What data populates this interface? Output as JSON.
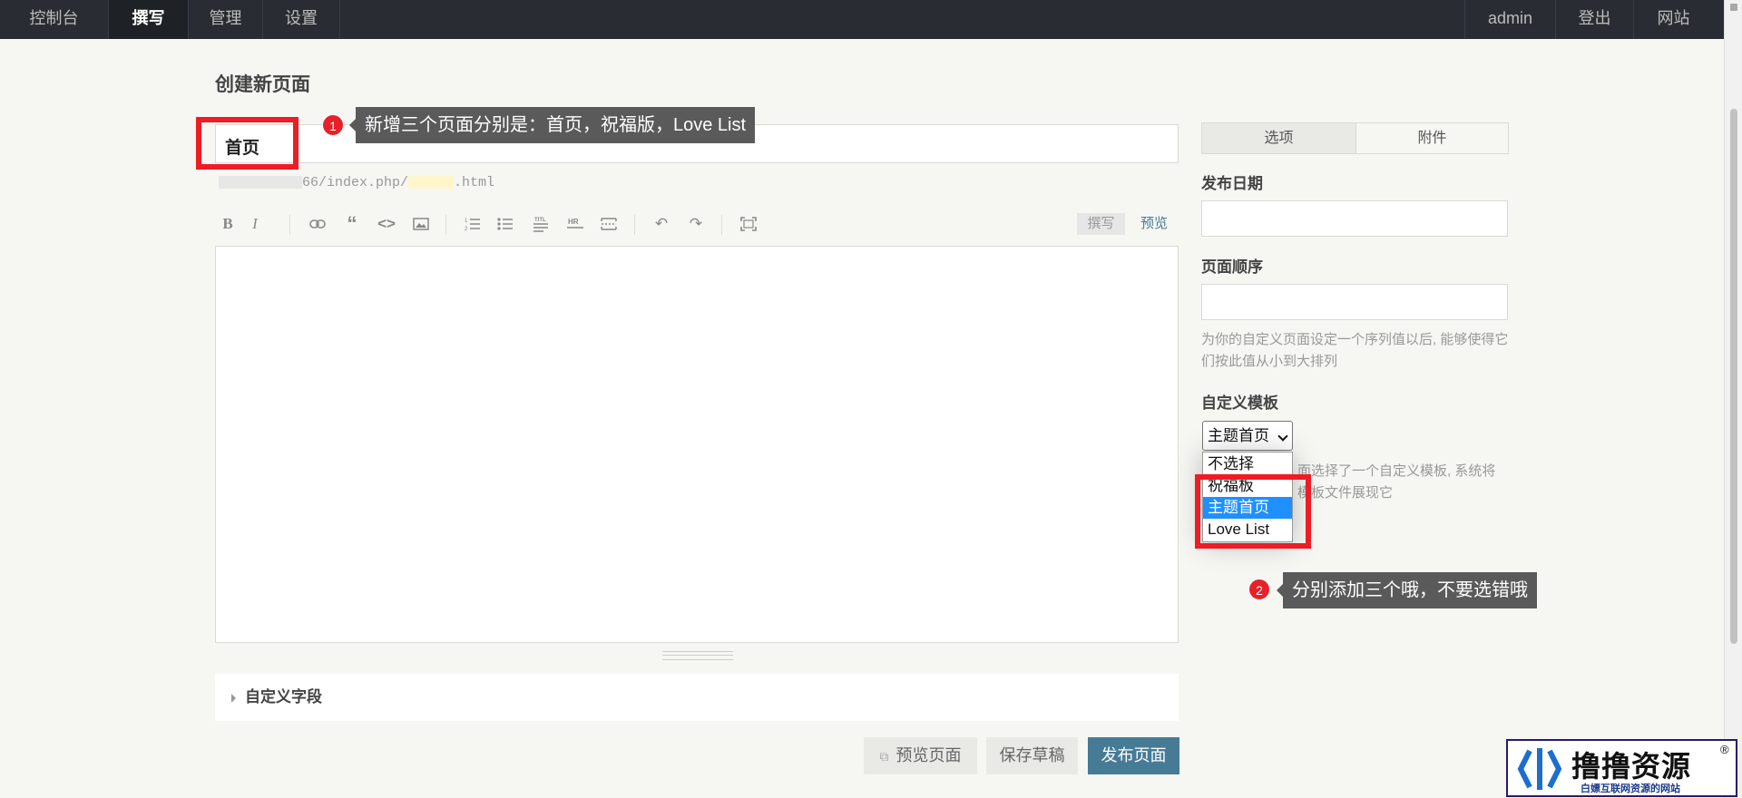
{
  "topbar": {
    "left": [
      "控制台",
      "撰写",
      "管理",
      "设置"
    ],
    "active": "撰写",
    "right": [
      "admin",
      "登出",
      "网站"
    ]
  },
  "page": {
    "title": "创建新页面",
    "page_title_value": "首页",
    "url_prefix": "66/index.php/",
    "url_suffix": ".html"
  },
  "editor": {
    "toolbar_icons": [
      "bold-icon",
      "italic-icon",
      "link-icon",
      "quote-icon",
      "code-icon",
      "image-icon",
      "ordered-list-icon",
      "unordered-list-icon",
      "heading-icon",
      "hr-icon",
      "more-icon",
      "undo-icon",
      "redo-icon",
      "fullscreen-icon"
    ],
    "mode_write": "撰写",
    "mode_preview": "预览",
    "content": ""
  },
  "custom_fields": {
    "label": "自定义字段"
  },
  "buttons": {
    "preview": "预览页面",
    "save_draft": "保存草稿",
    "publish": "发布页面"
  },
  "sidebar": {
    "tab_options": "选项",
    "tab_attachments": "附件",
    "publish_date_label": "发布日期",
    "publish_date_value": "",
    "order_label": "页面顺序",
    "order_value": "",
    "order_desc": "为你的自定义页面设定一个序列值以后, 能够使得它们按此值从小到大排列",
    "template_label": "自定义模板",
    "template_selected": "主题首页",
    "template_options": [
      "不选择",
      "祝福板",
      "主题首页",
      "Love List"
    ],
    "template_desc_line1": "面选择了一个自定义模板, 系统将",
    "template_desc_line2": "模板文件展现它"
  },
  "annotations": {
    "tip1_number": "1",
    "tip1_text": "新增三个页面分别是：首页，祝福版，Love List",
    "tip2_number": "2",
    "tip2_text": "分别添加三个哦，不要选错哦",
    "highlight_color": "#ee1c25"
  },
  "watermark": {
    "title": "撸撸资源",
    "subtitle": "白嫖互联网资源的网站",
    "reg": "®"
  },
  "colors": {
    "topbar": "#292d33",
    "accent": "#467b96",
    "selected_option": "#1e90ff"
  }
}
